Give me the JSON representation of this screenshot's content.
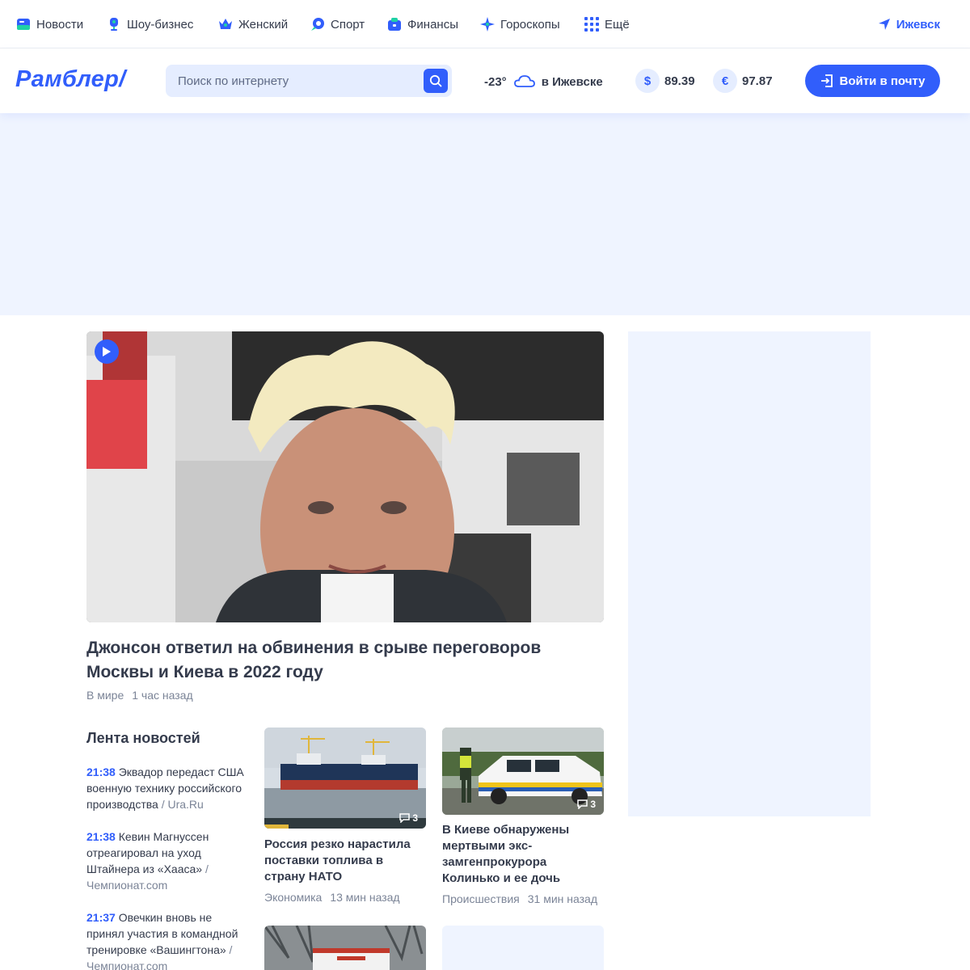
{
  "topnav": {
    "items": [
      {
        "label": "Новости",
        "icon": "news-icon",
        "color": "#315efb"
      },
      {
        "label": "Шоу-бизнес",
        "icon": "microphone-icon",
        "color": "#315efb"
      },
      {
        "label": "Женский",
        "icon": "crown-icon",
        "color": "#315efb"
      },
      {
        "label": "Спорт",
        "icon": "sport-icon",
        "color": "#315efb"
      },
      {
        "label": "Финансы",
        "icon": "wallet-icon",
        "color": "#315efb"
      },
      {
        "label": "Гороскопы",
        "icon": "star-icon",
        "color": "#315efb"
      },
      {
        "label": "Ещё",
        "icon": "grid-icon",
        "color": "#315efb"
      }
    ],
    "city": "Ижевск"
  },
  "header": {
    "logo": "Рамблер/",
    "search_placeholder": "Поиск по интернету",
    "weather": {
      "temp": "-23°",
      "location": "в Ижевске",
      "icon": "cloud-icon"
    },
    "rates": [
      {
        "symbol": "$",
        "value": "89.39"
      },
      {
        "symbol": "€",
        "value": "97.87"
      }
    ],
    "login_label": "Войти в почту"
  },
  "main_story": {
    "title": "Джонсон ответил на обвинения в срыве переговоров Москвы и Киева в 2022 году",
    "category": "В мире",
    "time": "1 час назад",
    "has_video": true
  },
  "feed": {
    "title": "Лента новостей",
    "items": [
      {
        "time": "21:38",
        "text": "Эквадор передаст США военную технику российского производства",
        "source": "Ura.Ru"
      },
      {
        "time": "21:38",
        "text": "Кевин Магнуссен отреагировал на уход Штайнера из «Хааса»",
        "source": "Чемпионат.com"
      },
      {
        "time": "21:37",
        "text": "Овечкин вновь не принял участия в командной тренировке «Вашингтона»",
        "source": "Чемпионат.com"
      }
    ]
  },
  "cards": [
    {
      "title": "Россия резко нарастила поставки топлива в страну НАТО",
      "category": "Экономика",
      "time": "13 мин назад",
      "comments": "3"
    },
    {
      "title": "В Киеве обнаружены мертвыми экс-замгенпрокурора Колинько и ее дочь",
      "category": "Происшествия",
      "time": "31 мин назад",
      "comments": "3"
    }
  ],
  "colors": {
    "accent": "#315efb",
    "text": "#343b4c",
    "muted": "#7b8497",
    "ad_bg": "#eff4ff"
  }
}
